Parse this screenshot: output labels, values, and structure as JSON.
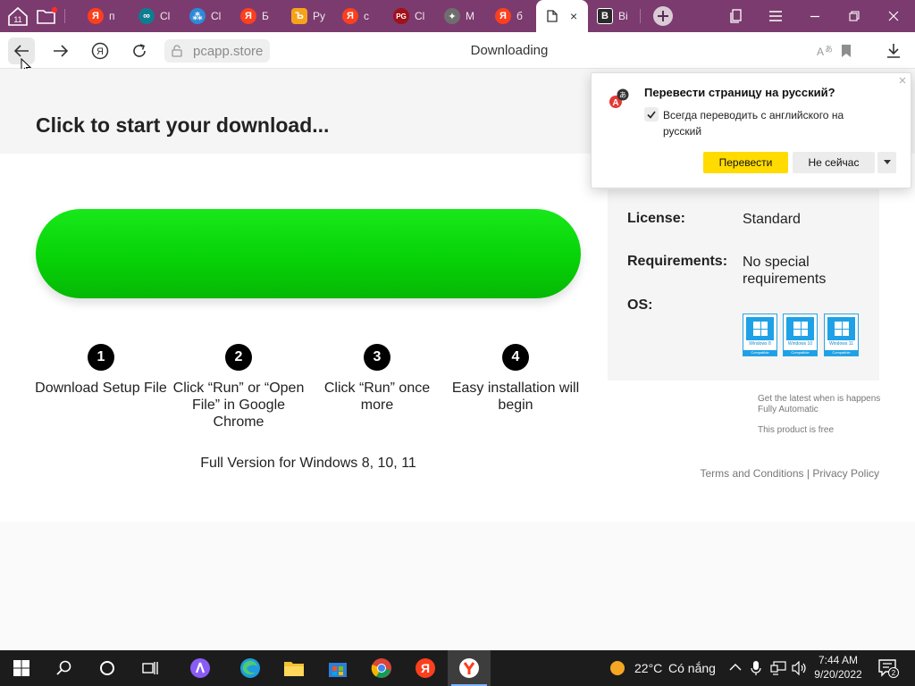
{
  "tabs": [
    {
      "fav_text": "Я",
      "fav_color": "#fc3f1d",
      "title": "п"
    },
    {
      "fav_text": "∞",
      "fav_color": "#0e7d8f",
      "title": "Cl"
    },
    {
      "fav_text": "⁂",
      "fav_color": "#2d8ad8",
      "title": "Cl"
    },
    {
      "fav_text": "Я",
      "fav_color": "#fc3f1d",
      "title": "Б"
    },
    {
      "fav_text": "Ъ",
      "fav_color": "#f7a21b",
      "title": "Ру"
    },
    {
      "fav_text": "Я",
      "fav_color": "#fc3f1d",
      "title": "с"
    },
    {
      "fav_text": "PG",
      "fav_color": "#a0111a",
      "title": "Cl"
    },
    {
      "fav_text": "✦",
      "fav_color": "#6e6e6e",
      "title": "M"
    },
    {
      "fav_text": "Я",
      "fav_color": "#fc3f1d",
      "title": "б"
    }
  ],
  "active_tab": {
    "icon": "document-icon",
    "close": "×"
  },
  "after_tab": {
    "fav_text": "B",
    "fav_color": "#2a2a2a",
    "title": "Bi"
  },
  "tabstrip": {
    "home_badge": "11"
  },
  "nav": {
    "url": "pcapp.store",
    "page_title": "Downloading"
  },
  "page": {
    "headline": "Click to start your download...",
    "steps": [
      {
        "num": "1",
        "text": "Download Setup File"
      },
      {
        "num": "2",
        "text": "Click “Run” or “Open File” in Google Chrome"
      },
      {
        "num": "3",
        "text": "Click “Run” once more"
      },
      {
        "num": "4",
        "text": "Easy installation will begin"
      }
    ],
    "full_version": "Full Version for Windows 8, 10, 11",
    "license_label": "License:",
    "license_value": "Standard",
    "requirements_label": "Requirements:",
    "requirements_value": "No special requirements",
    "os_label": "OS:",
    "os_badges": [
      {
        "ver": "Windows 8",
        "cmp": "Compatible"
      },
      {
        "ver": "Windows 10",
        "cmp": "Compatible"
      },
      {
        "ver": "Windows 11",
        "cmp": "Compatible"
      }
    ],
    "note_line1": "Get the latest when is happens",
    "note_line2": "Fully Automatic",
    "note_line3": "This product is free",
    "terms": "Terms and Conditions",
    "legal_sep": "|",
    "privacy": "Privacy Policy"
  },
  "translate_popup": {
    "title": "Перевести страницу на русский?",
    "checkbox_label": "Всегда переводить с английского на русский",
    "translate_button": "Перевести",
    "not_now_button": "Не сейчас"
  },
  "taskbar": {
    "temperature": "22°C",
    "weather": "Có nắng",
    "time": "7:44 AM",
    "date": "9/20/2022",
    "notification_count": "2"
  },
  "colors": {
    "tabstrip": "#7b3b6e",
    "download_button": "#07d307",
    "translate_button": "#ffdb00",
    "taskbar": "#1c1c1c"
  }
}
